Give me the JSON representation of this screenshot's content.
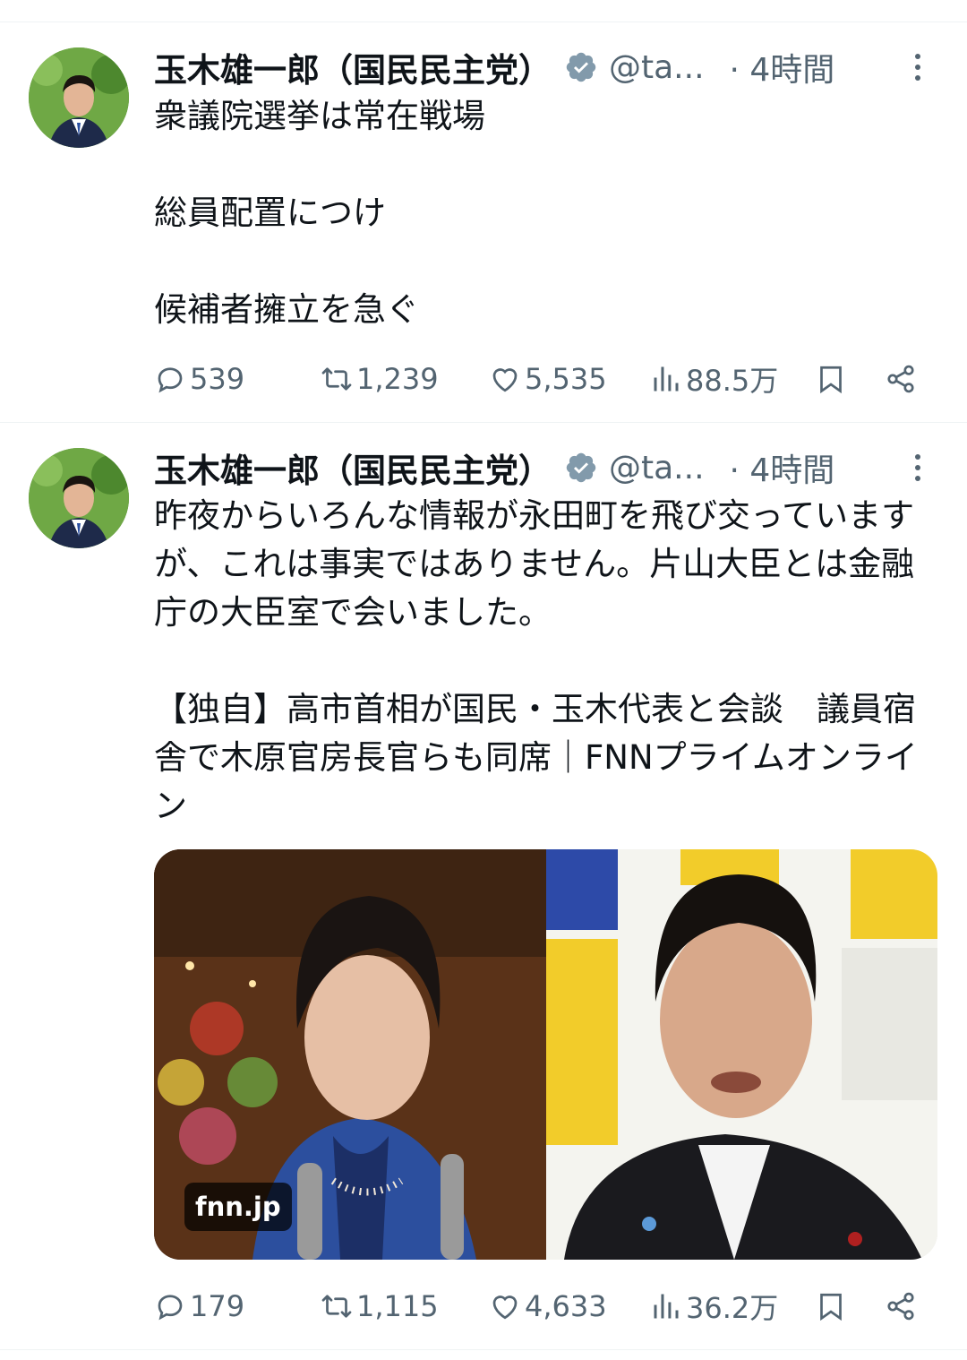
{
  "tweets": [
    {
      "author": {
        "name": "玉木雄一郎（国民民主党）",
        "handle": "@ta...",
        "time": "· 4時間"
      },
      "text": "衆議院選挙は常在戦場\n\n総員配置につけ\n\n候補者擁立を急ぐ",
      "stats": {
        "replies": "539",
        "retweets": "1,239",
        "likes": "5,535",
        "views": "88.5万"
      }
    },
    {
      "author": {
        "name": "玉木雄一郎（国民民主党）",
        "handle": "@ta...",
        "time": "· 4時間"
      },
      "text": "昨夜からいろんな情報が永田町を飛び交っていますが、これは事実ではありません。片山大臣とは金融庁の大臣室で会いました。\n\n【独自】高市首相が国民・玉木代表と会談　議員宿舎で木原官房長官らも同席｜FNNプライムオンライン",
      "card": {
        "domain": "fnn.jp"
      },
      "stats": {
        "replies": "179",
        "retweets": "1,115",
        "likes": "4,633",
        "views": "36.2万"
      }
    }
  ],
  "icons": {
    "verified": "verified-badge-icon",
    "more": "more-options-icon",
    "reply": "reply-icon",
    "retweet": "retweet-icon",
    "like": "heart-icon",
    "views": "views-chart-icon",
    "bookmark": "bookmark-icon",
    "share": "share-icon"
  },
  "colors": {
    "text": "#0f1419",
    "secondary": "#536471",
    "divider": "#eff3f4",
    "verified": "#829aab"
  }
}
